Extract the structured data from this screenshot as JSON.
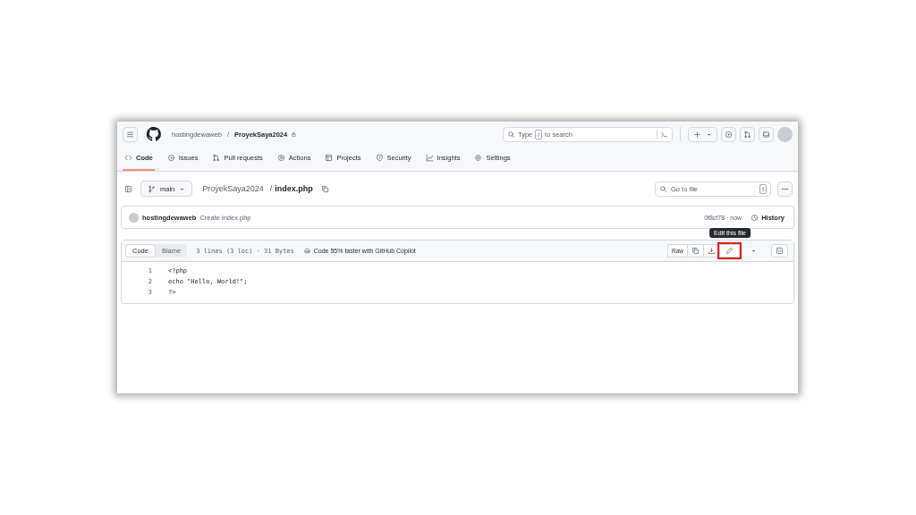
{
  "header": {
    "owner": "hostingdewaweb",
    "separator": "/",
    "repo": "ProyekSaya2024",
    "search": {
      "before": "Type",
      "key": "/",
      "after": "to search"
    }
  },
  "nav": [
    {
      "label": "Code",
      "selected": true
    },
    {
      "label": "Issues",
      "selected": false
    },
    {
      "label": "Pull requests",
      "selected": false
    },
    {
      "label": "Actions",
      "selected": false
    },
    {
      "label": "Projects",
      "selected": false
    },
    {
      "label": "Security",
      "selected": false
    },
    {
      "label": "Insights",
      "selected": false
    },
    {
      "label": "Settings",
      "selected": false
    }
  ],
  "file_bar": {
    "branch": "main",
    "repo": "ProyekSaya2024",
    "separator": "/",
    "file": "index.php",
    "go_to_file": {
      "placeholder": "Go to file",
      "shortcut": "t"
    }
  },
  "commit": {
    "author": "hostingdewaweb",
    "message": "Create index.php",
    "sha": "0f8cf78 · now",
    "history": "History"
  },
  "code_view": {
    "tabs": [
      {
        "label": "Code",
        "selected": true
      },
      {
        "label": "Blame",
        "selected": false
      }
    ],
    "info": "3 lines (3 loc) · 31 Bytes",
    "copilot": "Code 55% faster with GitHub Copilot",
    "raw": "Raw",
    "tooltip": "Edit this file",
    "edit_highlighted": true,
    "lines": [
      {
        "number": "1",
        "text": "<?php"
      },
      {
        "number": "2",
        "text": "echo \"Hello, World!\";"
      },
      {
        "number": "3",
        "text": "?>"
      }
    ]
  }
}
